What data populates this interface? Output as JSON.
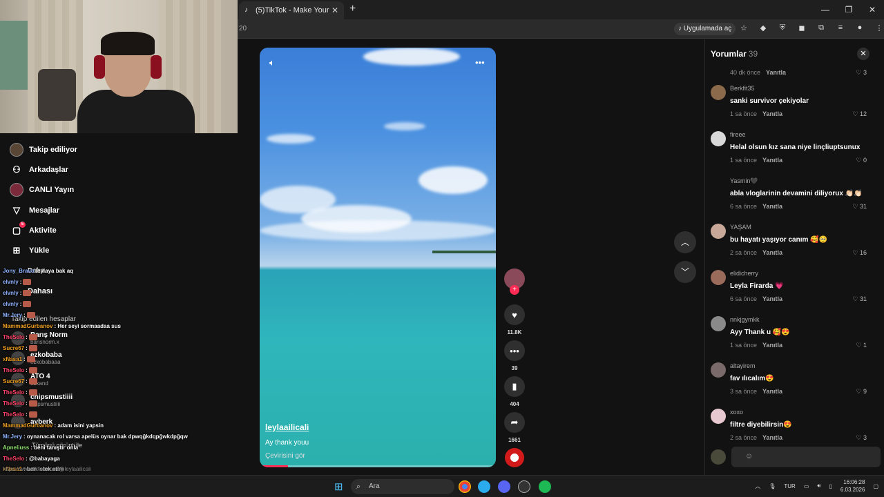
{
  "browser": {
    "tab_title": "(5)TikTok - Make Your Day",
    "tab_close": "✕",
    "new_tab": "+",
    "url_fragment": "20",
    "open_in_app": "Uygulamada aç"
  },
  "sidebar": {
    "items": [
      {
        "label": "Takip ediliyor",
        "icon": "avatar-icon"
      },
      {
        "label": "Arkadaşlar",
        "icon": "friends-icon"
      },
      {
        "label": "CANLI Yayın",
        "icon": "live-icon"
      },
      {
        "label": "Mesajlar",
        "icon": "send-icon"
      },
      {
        "label": "Aktivite",
        "icon": "activity-icon",
        "badge": "5"
      },
      {
        "label": "Yükle",
        "icon": "upload-icon"
      },
      {
        "label": "Daha..."
      },
      {
        "label": "Dahası"
      }
    ],
    "following_header": "Takip edilen hesaplar",
    "following": [
      {
        "name": "Barış Norm",
        "handle": "barisnorm.x"
      },
      {
        "name": "ezkobaba",
        "handle": "ezkobabaaa"
      },
      {
        "name": "ATO 4",
        "handle": "ozkand"
      },
      {
        "name": "chipsmustiiii",
        "handle": "chipsmustiiii"
      },
      {
        "name": "ayberk",
        "handle": ""
      }
    ],
    "see_all": "Tümünü görüntüle"
  },
  "chat": [
    {
      "user": "Jony_Bravo",
      "msg": "leylaya bak aq",
      "color": "#8fb3ff"
    },
    {
      "user": "elvnly",
      "msg": ":",
      "color": "#8fb3ff"
    },
    {
      "user": "elvnly",
      "msg": ":",
      "color": "#8fb3ff"
    },
    {
      "user": "elvnly",
      "msg": ":",
      "color": "#8fb3ff"
    },
    {
      "user": "Mr.Jery",
      "msg": ":",
      "color": "#8fb3ff"
    },
    {
      "user": "MammadGurbanov",
      "msg": ": Her seyi sormaadaa sus",
      "color": "#f0a020"
    },
    {
      "user": "TheSelo",
      "msg": ":",
      "color": "#ff4466"
    },
    {
      "user": "Sucre67",
      "msg": ":",
      "color": "#f0a020"
    },
    {
      "user": "xNasa1",
      "msg": ":",
      "color": "#f0a020"
    },
    {
      "user": "TheSelo",
      "msg": ":",
      "color": "#ff4466"
    },
    {
      "user": "Sucre67",
      "msg": ":",
      "color": "#f0a020"
    },
    {
      "user": "TheSelo",
      "msg": ":",
      "color": "#ff4466"
    },
    {
      "user": "TheSelo",
      "msg": ":",
      "color": "#ff4466"
    },
    {
      "user": "TheSelo",
      "msg": ":",
      "color": "#ff4466"
    },
    {
      "user": "MammadGurbanov",
      "msg": ": adam isini yapsin",
      "color": "#f0a020"
    },
    {
      "user": "Mr.Jery",
      "msg": ": oynanacak rol varsa apelüs oynar bak dpwqğkdqpğwkdpğqw",
      "color": "#8fb3ff"
    },
    {
      "user": "Apneliuss",
      "msg": ": beni tanıştır onla",
      "color": "#8fe06f"
    },
    {
      "user": "TheSelo",
      "msg": ": @babayaga",
      "color": "#ff4466"
    },
    {
      "user": "xNasa1",
      "msg": ": ben istek atim",
      "color": "#f0a020"
    },
    {
      "user": "xNasa1",
      "msg": ": kıza",
      "color": "#f0a020"
    },
    {
      "user": "eeriq",
      "msg": ": senide oynatsın",
      "color": "#ff4466"
    }
  ],
  "status_url": "https://www.tiktok.com/@leylaailicali",
  "video": {
    "username": "leylaailicali",
    "caption": "Ay thank youu",
    "translate": "Çevirisini gör",
    "progress": 0.12
  },
  "actions": {
    "likes": "11.8K",
    "comments": "39",
    "saves": "404",
    "shares": "1661"
  },
  "comments": {
    "title": "Yorumlar",
    "count": "39",
    "close": "✕",
    "reply_label": "Yanıtla",
    "items": [
      {
        "user": "",
        "text": "",
        "time": "40 dk önce",
        "likes": "3",
        "partial": true
      },
      {
        "user": "Berkfit35",
        "text": "sanki survivor çekiyolar",
        "time": "1 sa önce",
        "likes": "12",
        "avatar": "#8a6a4a"
      },
      {
        "user": "fireee",
        "text": "Helal olsun kız sana niye linçliuptsunux",
        "time": "1 sa önce",
        "likes": "0",
        "avatar": "#d8d8d8"
      },
      {
        "user": "Yasmin🖤",
        "text": "abla vloglarinin devamini diliyorux 👏🏻👏🏻",
        "time": "6 sa önce",
        "likes": "31",
        "avatar": "#121212"
      },
      {
        "user": "YAŞAM",
        "text": "bu hayatı yaşıyor canım 🥰🥺",
        "time": "2 sa önce",
        "likes": "16",
        "avatar": "#c8a898"
      },
      {
        "user": "elidicherry",
        "text": "Leyla Firarda 💗",
        "time": "6 sa önce",
        "likes": "31",
        "avatar": "#9a6a5a"
      },
      {
        "user": "nnkjgymkk",
        "text": "Ayy Thank u 🥰😍",
        "time": "1 sa önce",
        "likes": "1",
        "avatar": "#8a8a8a"
      },
      {
        "user": "altayirem",
        "text": "fav ılıcalım😍",
        "time": "3 sa önce",
        "likes": "9",
        "avatar": "#7a6a6a"
      },
      {
        "user": "xoxo",
        "text": "filtre diyebilirsin😍",
        "time": "2 sa önce",
        "likes": "3",
        "avatar": "#e8c8d0"
      }
    ]
  },
  "taskbar": {
    "search_placeholder": "Ara",
    "lang": "TUR",
    "time": "16:06:28",
    "date": "6.03.2026"
  }
}
